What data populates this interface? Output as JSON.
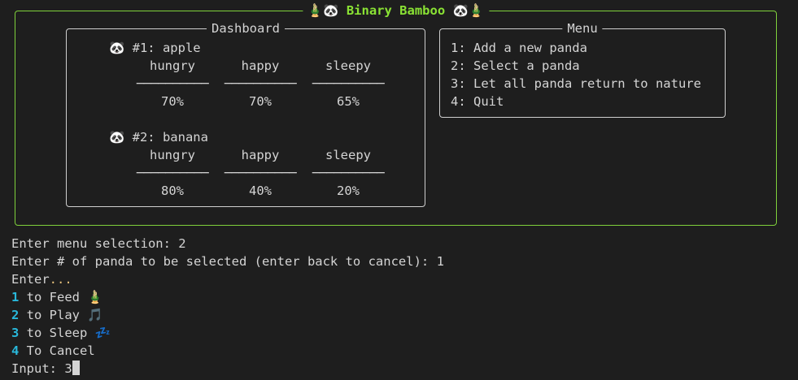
{
  "app": {
    "title": "🎍🐼 Binary Bamboo 🐼🎍"
  },
  "dashboard": {
    "title": "Dashboard",
    "pandas": [
      {
        "label": "🐼 #1: apple",
        "stats": [
          {
            "name": "hungry",
            "rule": "──────────",
            "value": "70%"
          },
          {
            "name": "happy",
            "rule": "──────────",
            "value": "70%"
          },
          {
            "name": "sleepy",
            "rule": "──────────",
            "value": "65%"
          }
        ]
      },
      {
        "label": "🐼 #2: banana",
        "stats": [
          {
            "name": "hungry",
            "rule": "──────────",
            "value": "80%"
          },
          {
            "name": "happy",
            "rule": "──────────",
            "value": "40%"
          },
          {
            "name": "sleepy",
            "rule": "──────────",
            "value": "20%"
          }
        ]
      }
    ]
  },
  "menu": {
    "title": "Menu",
    "items": [
      "1: Add a new panda",
      "2: Select a panda",
      "3: Let all panda return to nature",
      "4: Quit"
    ]
  },
  "terminal": {
    "lines": [
      "Enter menu selection: 2",
      "Enter # of panda to be selected (enter back to cancel): 1"
    ],
    "enter_prefix": "Enter",
    "enter_dots": "...",
    "options": [
      {
        "num": "1",
        "text": " to Feed 🎍"
      },
      {
        "num": "2",
        "text": " to Play 🎵"
      },
      {
        "num": "3",
        "text": " to Sleep 💤"
      },
      {
        "num": "4",
        "text": " To Cancel"
      }
    ],
    "input_prompt": "Input: ",
    "input_value": "3"
  },
  "colors": {
    "background": "#1e1e1e",
    "frame_green": "#7fd13b",
    "title_green": "#8ae234",
    "option_number": "#29b8db",
    "dots": "#e5c07b"
  }
}
